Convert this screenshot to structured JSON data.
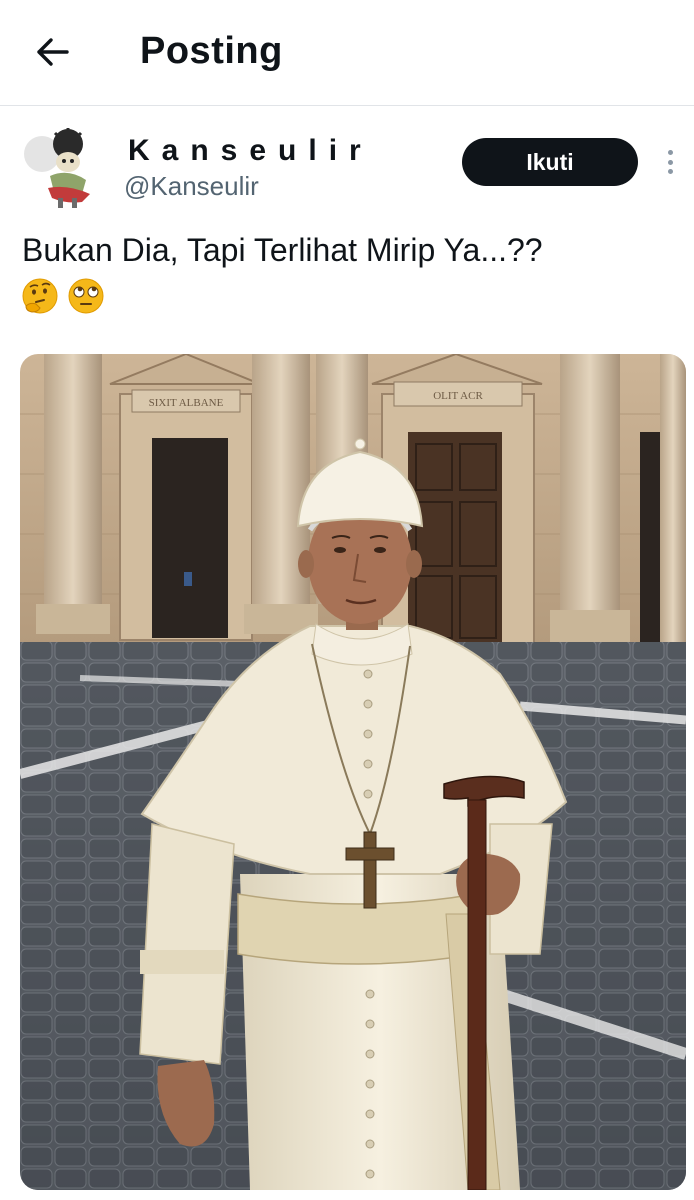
{
  "header": {
    "title": "Posting",
    "back_icon": "arrow-left-icon"
  },
  "post": {
    "author": {
      "display_name": "Kanseulir",
      "handle": "@Kanseulir",
      "avatar_icon": "cartoon-avatar"
    },
    "follow_label": "Ikuti",
    "more_icon": "more-vertical-icon",
    "text": "Bukan Dia, Tapi Terlihat Mirip Ya...??",
    "emojis": [
      "thinking-face-emoji",
      "face-with-rolling-eyes-emoji"
    ],
    "media": {
      "alt": "",
      "inscriptions": [
        "SIXIT ALBANE",
        "OLIT ACR"
      ]
    }
  },
  "colors": {
    "text": "#0f1419",
    "secondary": "#536471",
    "follow_bg": "#0f1419",
    "divider": "#e1e4e8"
  }
}
